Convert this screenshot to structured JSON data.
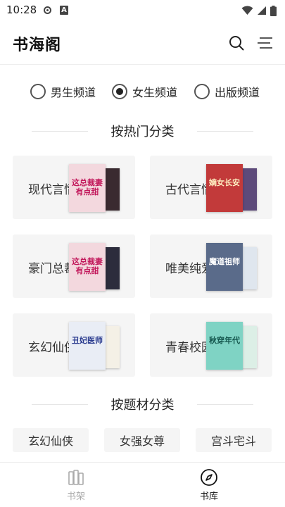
{
  "status_bar": {
    "time": "10:28",
    "notif_letter": "A"
  },
  "header": {
    "title": "书海阁"
  },
  "channels": [
    {
      "label": "男生频道",
      "checked": false
    },
    {
      "label": "女生频道",
      "checked": true
    },
    {
      "label": "出版频道",
      "checked": false
    }
  ],
  "hot_section": {
    "title": "按热门分类",
    "categories": [
      {
        "label": "现代言情",
        "cover_front_text": "这总裁妻有点甜",
        "cover_front_color": "#f3d8de",
        "cover_back_color": "#3a2a30"
      },
      {
        "label": "古代言情",
        "cover_front_text": "嫡女长安",
        "cover_front_color": "#c23a3a",
        "cover_back_color": "#5d4a7a"
      },
      {
        "label": "豪门总裁",
        "cover_front_text": "这总裁妻有点甜",
        "cover_front_color": "#f3d8de",
        "cover_back_color": "#2c2c3c"
      },
      {
        "label": "唯美纯爱",
        "cover_front_text": "魔道祖师",
        "cover_front_color": "#5a6b8a",
        "cover_back_color": "#dfe6ee"
      },
      {
        "label": "玄幻仙侠",
        "cover_front_text": "丑妃医师",
        "cover_front_color": "#e9edf5",
        "cover_back_color": "#f4f0e6"
      },
      {
        "label": "青春校园",
        "cover_front_text": "秋穿年代",
        "cover_front_color": "#7fd3c4",
        "cover_back_color": "#dcefe6"
      }
    ]
  },
  "theme_section": {
    "title": "按题材分类",
    "chips": [
      "玄幻仙侠",
      "女强女尊",
      "宫斗宅斗"
    ]
  },
  "bottom_nav": {
    "items": [
      {
        "label": "书架",
        "icon": "bookshelf-icon",
        "active": false
      },
      {
        "label": "书库",
        "icon": "compass-icon",
        "active": true
      }
    ]
  }
}
